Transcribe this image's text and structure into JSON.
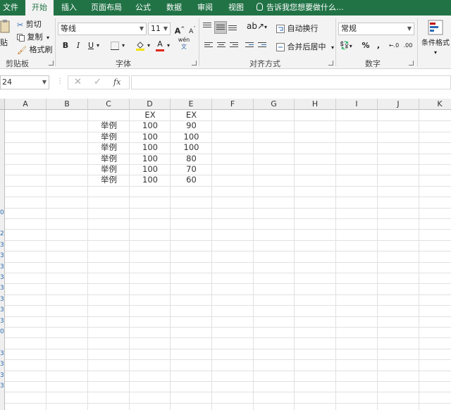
{
  "ribbon_tabs": [
    "文件",
    "开始",
    "插入",
    "页面布局",
    "公式",
    "数据",
    "审阅",
    "视图"
  ],
  "tell_me": "告诉我您想要做什么...",
  "clipboard": {
    "cut": "剪切",
    "copy": "复制",
    "format_painter": "格式刷",
    "paste_partial": "贴",
    "group_label": "剪贴板"
  },
  "font": {
    "name": "等线",
    "size": "11",
    "bold": "B",
    "italic": "I",
    "underline": "U",
    "group_label": "字体",
    "grow": "A",
    "shrink": "A",
    "fill_letter": "A",
    "wen": "wén"
  },
  "alignment": {
    "wrap_text": "自动换行",
    "merge_center": "合并后居中",
    "group_label": "对齐方式"
  },
  "number": {
    "format": "常规",
    "percent": "%",
    "comma": ",",
    "group_label": "数字"
  },
  "styles": {
    "conditional_format": "条件格式"
  },
  "name_box": "24",
  "columns": [
    "A",
    "B",
    "C",
    "D",
    "E",
    "F",
    "G",
    "H",
    "I",
    "J",
    "K"
  ],
  "row_numbers_visible": [
    "0",
    "2",
    "3",
    "3",
    "3",
    "3",
    "3",
    "3",
    "3",
    "3",
    "0",
    "3",
    "3",
    "3",
    "3"
  ],
  "sheet": {
    "header_row": {
      "D": "EX",
      "E": "EX"
    },
    "rows": [
      {
        "C": "举例",
        "D": "100",
        "E": "90"
      },
      {
        "C": "举例",
        "D": "100",
        "E": "100"
      },
      {
        "C": "举例",
        "D": "100",
        "E": "100"
      },
      {
        "C": "举例",
        "D": "100",
        "E": "80"
      },
      {
        "C": "举例",
        "D": "100",
        "E": "70"
      },
      {
        "C": "举例",
        "D": "100",
        "E": "60"
      }
    ]
  },
  "colors": {
    "brand": "#217346",
    "ribbon_bg": "#f3f3f3",
    "gridline": "#e1e1e1"
  }
}
